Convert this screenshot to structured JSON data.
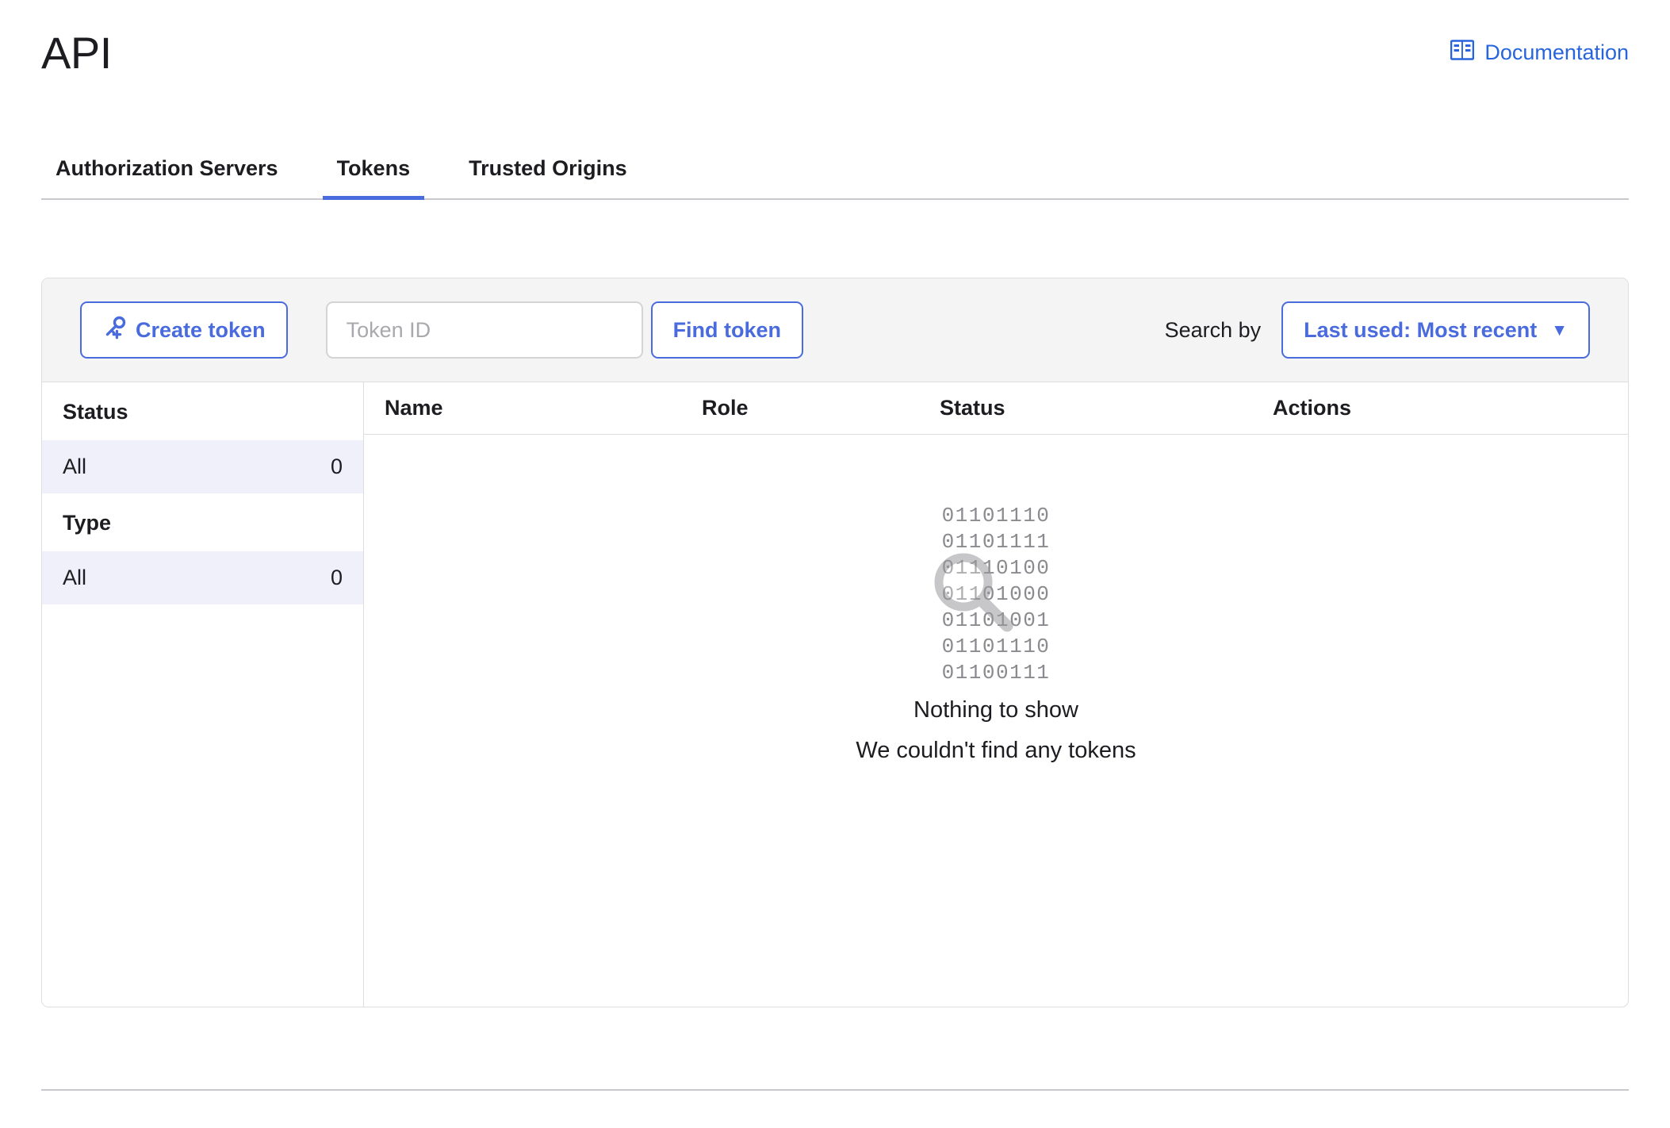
{
  "header": {
    "title": "API",
    "documentation_link": "Documentation",
    "documentation_icon": "book-icon",
    "link_color": "#2864dc"
  },
  "tabs": [
    {
      "label": "Authorization Servers",
      "active": false
    },
    {
      "label": "Tokens",
      "active": true
    },
    {
      "label": "Trusted Origins",
      "active": false
    }
  ],
  "toolbar": {
    "create_token_label": "Create token",
    "create_token_icon": "key-plus-icon",
    "token_id_placeholder": "Token ID",
    "token_id_value": "",
    "find_token_label": "Find token",
    "search_by_label": "Search by",
    "sort_selected": "Last used: Most recent",
    "sort_caret_icon": "chevron-down-icon"
  },
  "filters": {
    "groups": [
      {
        "title": "Status",
        "rows": [
          {
            "label": "All",
            "count": "0",
            "selected": true
          }
        ]
      },
      {
        "title": "Type",
        "rows": [
          {
            "label": "All",
            "count": "0",
            "selected": true
          }
        ]
      }
    ]
  },
  "table": {
    "columns": [
      "Name",
      "Role",
      "Status",
      "Actions"
    ],
    "rows": []
  },
  "empty_state": {
    "binary_lines": [
      "01101110",
      "01101111",
      "01110100",
      "01101000",
      "01101001",
      "01101110",
      "01100111"
    ],
    "magnifier_icon": "magnifier-icon",
    "title": "Nothing to show",
    "subtitle": "We couldn't find any tokens"
  },
  "colors": {
    "accent_blue": "#4a6bdd",
    "link_blue": "#2864dc",
    "toolbar_bg": "#f4f4f4",
    "selected_row_bg": "#f0f0fb",
    "border": "#dededf",
    "text": "#1d1d21",
    "muted": "#8b8b8f"
  }
}
